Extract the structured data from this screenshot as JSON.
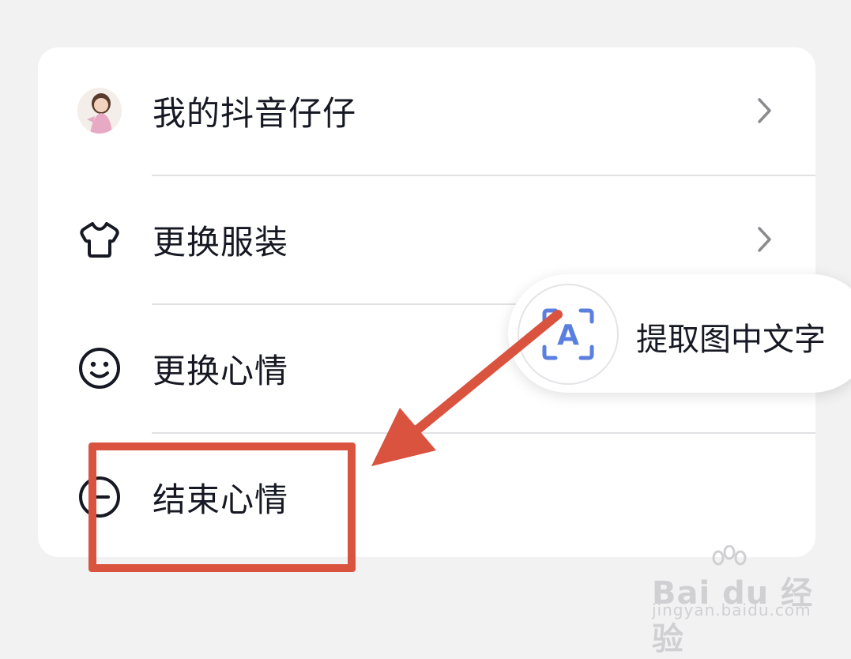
{
  "menu": {
    "items": [
      {
        "label": "我的抖音仔仔",
        "icon": "avatar-icon",
        "has_chevron": true
      },
      {
        "label": "更换服装",
        "icon": "tshirt-icon",
        "has_chevron": true
      },
      {
        "label": "更换心情",
        "icon": "smiley-icon",
        "has_chevron": false
      },
      {
        "label": "结束心情",
        "icon": "minus-circle-icon",
        "has_chevron": false
      }
    ]
  },
  "ocr_popup": {
    "icon_letter": "A",
    "label": "提取图中文字"
  },
  "watermark": {
    "brand": "Bai du 经验",
    "url": "jingyan.baidu.com"
  },
  "colors": {
    "background": "#f2f2f3",
    "card": "#ffffff",
    "text": "#161823",
    "divider": "#e1e1e4",
    "annotation_red": "#d9533f",
    "ocr_blue": "#5b7fe0"
  }
}
